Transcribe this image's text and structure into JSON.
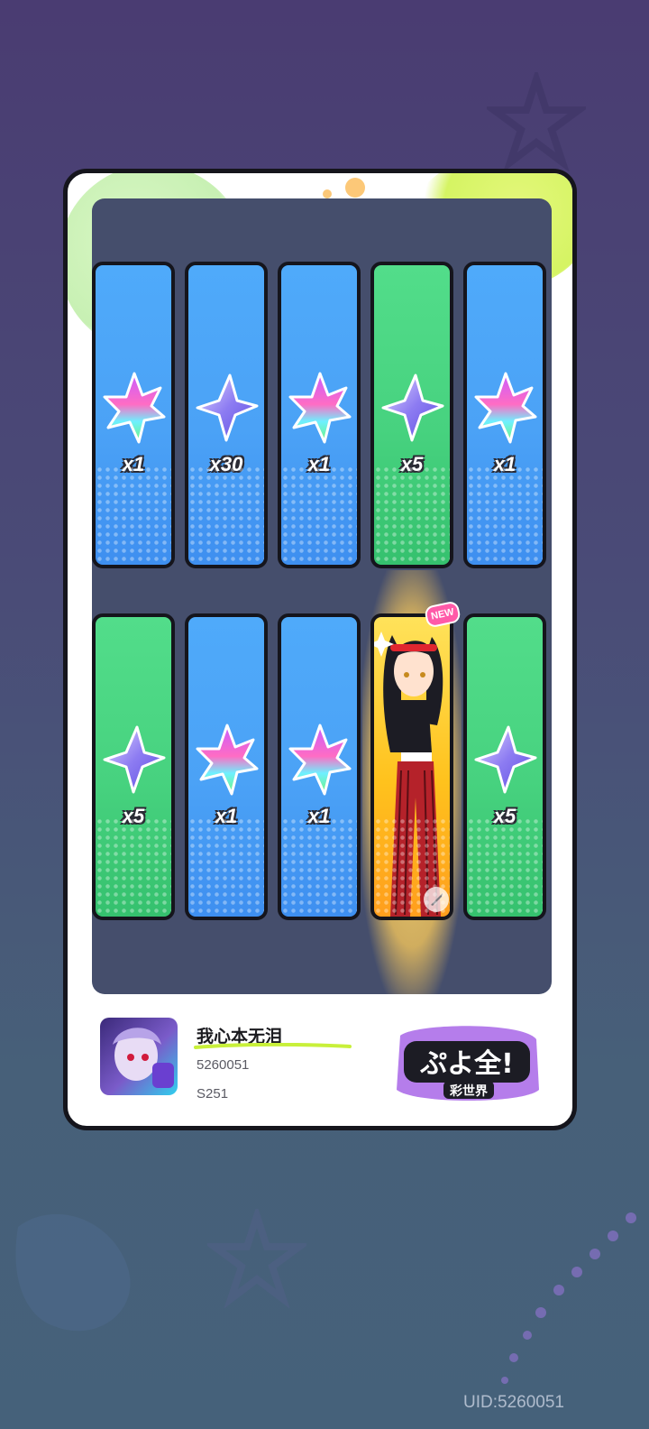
{
  "cards": {
    "row1": [
      {
        "color": "blue",
        "gem": "rainbow-gem-icon",
        "qty": "x1"
      },
      {
        "color": "blue",
        "gem": "purple-gem-icon",
        "qty": "x30"
      },
      {
        "color": "blue",
        "gem": "rainbow-gem-icon",
        "qty": "x1"
      },
      {
        "color": "green",
        "gem": "purple-gem-icon",
        "qty": "x5"
      },
      {
        "color": "blue",
        "gem": "rainbow-gem-icon",
        "qty": "x1"
      }
    ],
    "row2": [
      {
        "color": "green",
        "gem": "purple-gem-icon",
        "qty": "x5"
      },
      {
        "color": "blue",
        "gem": "rainbow-gem-icon",
        "qty": "x1"
      },
      {
        "color": "blue",
        "gem": "rainbow-gem-icon",
        "qty": "x1"
      },
      {
        "color": "gold",
        "gem": "character-portrait",
        "qty": ""
      },
      {
        "color": "green",
        "gem": "purple-gem-icon",
        "qty": "x5"
      }
    ],
    "new_badge": "NEW"
  },
  "player": {
    "name": "我心本无泪",
    "id_number": "5260051",
    "server": "S251"
  },
  "logo_text": {
    "main": "ぷよ全!",
    "sub": "彩世界"
  },
  "uid_label": "UID:5260051",
  "colors": {
    "blue_card": "#4ba2f6",
    "green_card": "#47d27f",
    "gold_card": "#ffc21d",
    "panel": "#454e6c"
  }
}
